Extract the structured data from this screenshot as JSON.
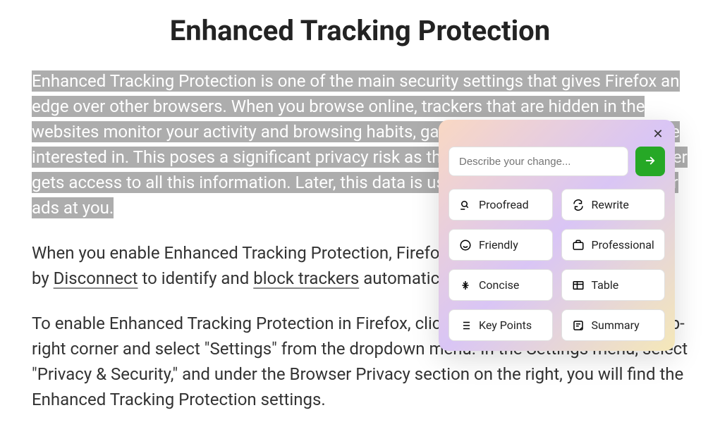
{
  "page": {
    "title": "Enhanced Tracking Protection",
    "para1_highlighted": "Enhanced Tracking Protection is one of the main security settings that gives Firefox an edge over other browsers. When you browse online, trackers that are hidden in the websites monitor your activity and browsing habits, gathering data on the things you're interested in. This poses a significant privacy risk as the company managing the tracker gets access to all this information. Later, this data is used by companies to target their ads at you.",
    "para2_pre": "When you enable Enhanced Tracking Protection, Firefox uses a list of known trackers by ",
    "para2_link1": "Disconnect",
    "para2_mid": " to identify and ",
    "para2_link2": "block trackers",
    "para2_post": " automatically.",
    "para3": "To enable Enhanced Tracking Protection in Firefox, click the hamburger icon on the top-right corner and select \"Settings\" from the dropdown menu. In the Settings menu, select \"Privacy & Security,\" and under the Browser Privacy section on the right, you will find the Enhanced Tracking Protection settings."
  },
  "popup": {
    "input_placeholder": "Describe your change...",
    "options": {
      "proofread": "Proofread",
      "rewrite": "Rewrite",
      "friendly": "Friendly",
      "professional": "Professional",
      "concise": "Concise",
      "table": "Table",
      "keypoints": "Key Points",
      "summary": "Summary"
    }
  }
}
